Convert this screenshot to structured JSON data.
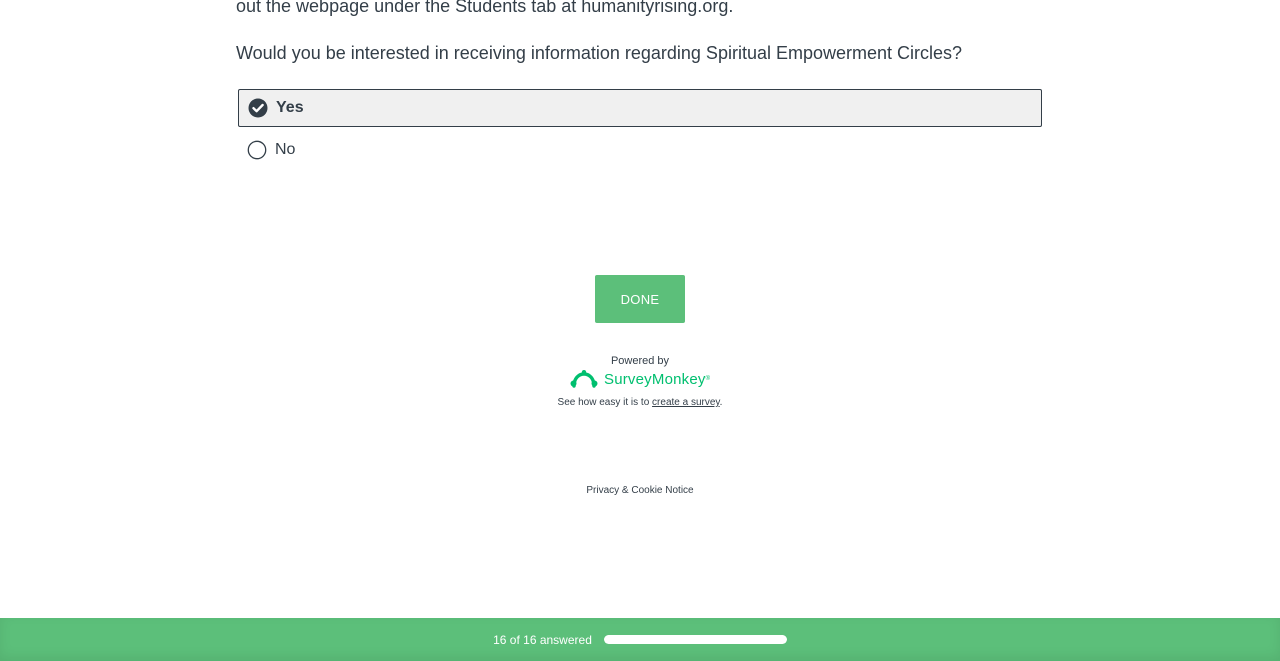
{
  "question": {
    "previous_text_tail": "out the webpage under the Students tab at humanityrising.org.",
    "text": "Would you be interested in receiving information regarding Spiritual Empowerment Circles?",
    "options": [
      {
        "label": "Yes",
        "selected": true
      },
      {
        "label": "No",
        "selected": false
      }
    ]
  },
  "done_button": {
    "label": "DONE"
  },
  "branding": {
    "powered_by": "Powered by",
    "brand_name": "SurveyMonkey",
    "brand_tm": "®",
    "cta_prefix": "See how easy it is to ",
    "cta_link": "create a survey",
    "cta_suffix": "."
  },
  "privacy_link": "Privacy & Cookie Notice",
  "progress": {
    "text": "16 of 16 answered",
    "answered": 16,
    "total": 16
  },
  "colors": {
    "accent": "#5cbf7a",
    "brand": "#00bf6f",
    "text": "#333e48"
  }
}
